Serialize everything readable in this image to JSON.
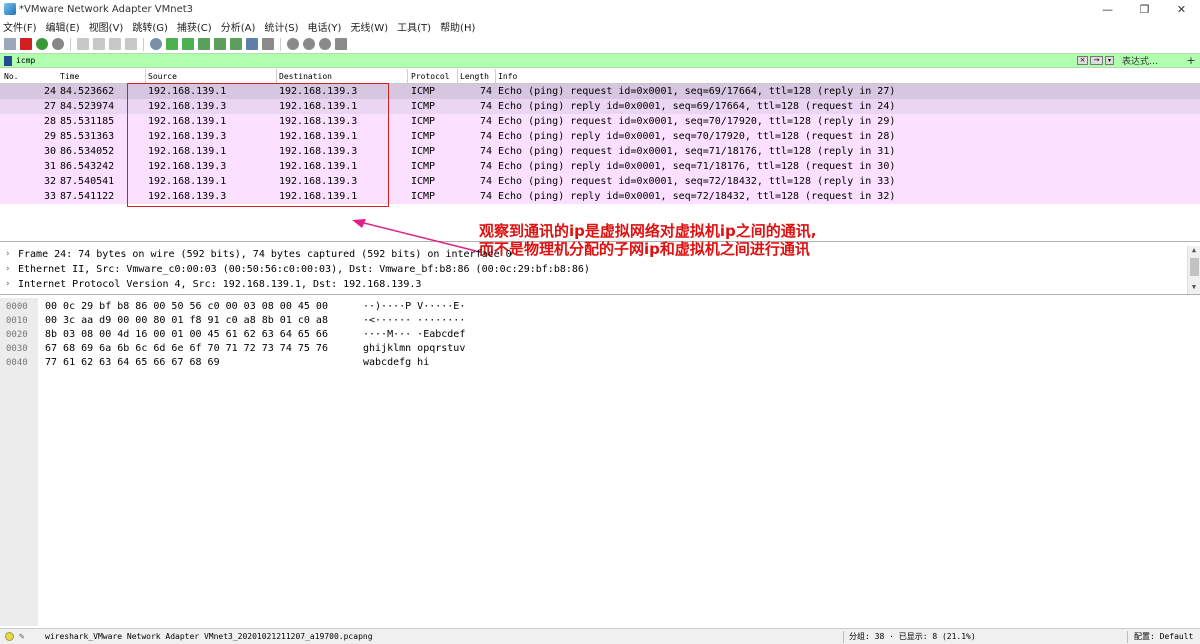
{
  "window": {
    "title": "*VMware Network Adapter VMnet3",
    "controls": {
      "minimize": "—",
      "maximize": "❐",
      "close": "✕"
    }
  },
  "menubar": {
    "items": [
      "文件(F)",
      "编辑(E)",
      "视图(V)",
      "跳转(G)",
      "捕获(C)",
      "分析(A)",
      "统计(S)",
      "电话(Y)",
      "无线(W)",
      "工具(T)",
      "帮助(H)"
    ]
  },
  "filter": {
    "value": "icmp",
    "expression_label": "表达式…",
    "plus_label": "+"
  },
  "packet_list": {
    "columns": [
      "No.",
      "Time",
      "Source",
      "Destination",
      "Protocol",
      "Length",
      "Info"
    ],
    "rows": [
      {
        "no": "24",
        "time": "84.523662",
        "src": "192.168.139.1",
        "dst": "192.168.139.3",
        "proto": "ICMP",
        "len": "74",
        "info": "Echo (ping) request  id=0x0001, seq=69/17664, ttl=128 (reply in 27)"
      },
      {
        "no": "27",
        "time": "84.523974",
        "src": "192.168.139.3",
        "dst": "192.168.139.1",
        "proto": "ICMP",
        "len": "74",
        "info": "Echo (ping) reply    id=0x0001, seq=69/17664, ttl=128 (request in 24)"
      },
      {
        "no": "28",
        "time": "85.531185",
        "src": "192.168.139.1",
        "dst": "192.168.139.3",
        "proto": "ICMP",
        "len": "74",
        "info": "Echo (ping) request  id=0x0001, seq=70/17920, ttl=128 (reply in 29)"
      },
      {
        "no": "29",
        "time": "85.531363",
        "src": "192.168.139.3",
        "dst": "192.168.139.1",
        "proto": "ICMP",
        "len": "74",
        "info": "Echo (ping) reply    id=0x0001, seq=70/17920, ttl=128 (request in 28)"
      },
      {
        "no": "30",
        "time": "86.534052",
        "src": "192.168.139.1",
        "dst": "192.168.139.3",
        "proto": "ICMP",
        "len": "74",
        "info": "Echo (ping) request  id=0x0001, seq=71/18176, ttl=128 (reply in 31)"
      },
      {
        "no": "31",
        "time": "86.543242",
        "src": "192.168.139.3",
        "dst": "192.168.139.1",
        "proto": "ICMP",
        "len": "74",
        "info": "Echo (ping) reply    id=0x0001, seq=71/18176, ttl=128 (request in 30)"
      },
      {
        "no": "32",
        "time": "87.540541",
        "src": "192.168.139.1",
        "dst": "192.168.139.3",
        "proto": "ICMP",
        "len": "74",
        "info": "Echo (ping) request  id=0x0001, seq=72/18432, ttl=128 (reply in 33)"
      },
      {
        "no": "33",
        "time": "87.541122",
        "src": "192.168.139.3",
        "dst": "192.168.139.1",
        "proto": "ICMP",
        "len": "74",
        "info": "Echo (ping) reply    id=0x0001, seq=72/18432, ttl=128 (request in 32)"
      }
    ],
    "colors": {
      "selected": "#d7c6e0",
      "related": "#ead5f2",
      "icmp": "#fce0ff"
    }
  },
  "annotation": {
    "line1": "观察到通讯的ip是虚拟网络对虚拟机ip之间的通讯,",
    "line2": "而不是物理机分配的子网ip和虚拟机之间进行通讯",
    "color": "#e01010"
  },
  "details": {
    "rows": [
      "Frame 24: 74 bytes on wire (592 bits), 74 bytes captured (592 bits) on interface 0",
      "Ethernet II, Src: Vmware_c0:00:03 (00:50:56:c0:00:03), Dst: Vmware_bf:b8:86 (00:0c:29:bf:b8:86)",
      "Internet Protocol Version 4, Src: 192.168.139.1, Dst: 192.168.139.3"
    ],
    "expand_icon": "›"
  },
  "bytes": {
    "rows": [
      {
        "offset": "0000",
        "hex": "00 0c 29 bf b8 86 00 50  56 c0 00 03 08 00 45 00",
        "ascii": "··)····P V·····E·"
      },
      {
        "offset": "0010",
        "hex": "00 3c aa d9 00 00 80 01  f8 91 c0 a8 8b 01 c0 a8",
        "ascii": "·<······ ········"
      },
      {
        "offset": "0020",
        "hex": "8b 03 08 00 4d 16 00 01  00 45 61 62 63 64 65 66",
        "ascii": "····M··· ·Eabcdef"
      },
      {
        "offset": "0030",
        "hex": "67 68 69 6a 6b 6c 6d 6e  6f 70 71 72 73 74 75 76",
        "ascii": "ghijklmn opqrstuv"
      },
      {
        "offset": "0040",
        "hex": "77 61 62 63 64 65 66 67  68 69",
        "ascii": "wabcdefg hi"
      }
    ]
  },
  "statusbar": {
    "file": "wireshark_VMware Network Adapter VMnet3_20201021211207_a19700.pcapng",
    "packets": "分组: 38 · 已显示: 8 (21.1%)",
    "profile": "配置: Default"
  }
}
